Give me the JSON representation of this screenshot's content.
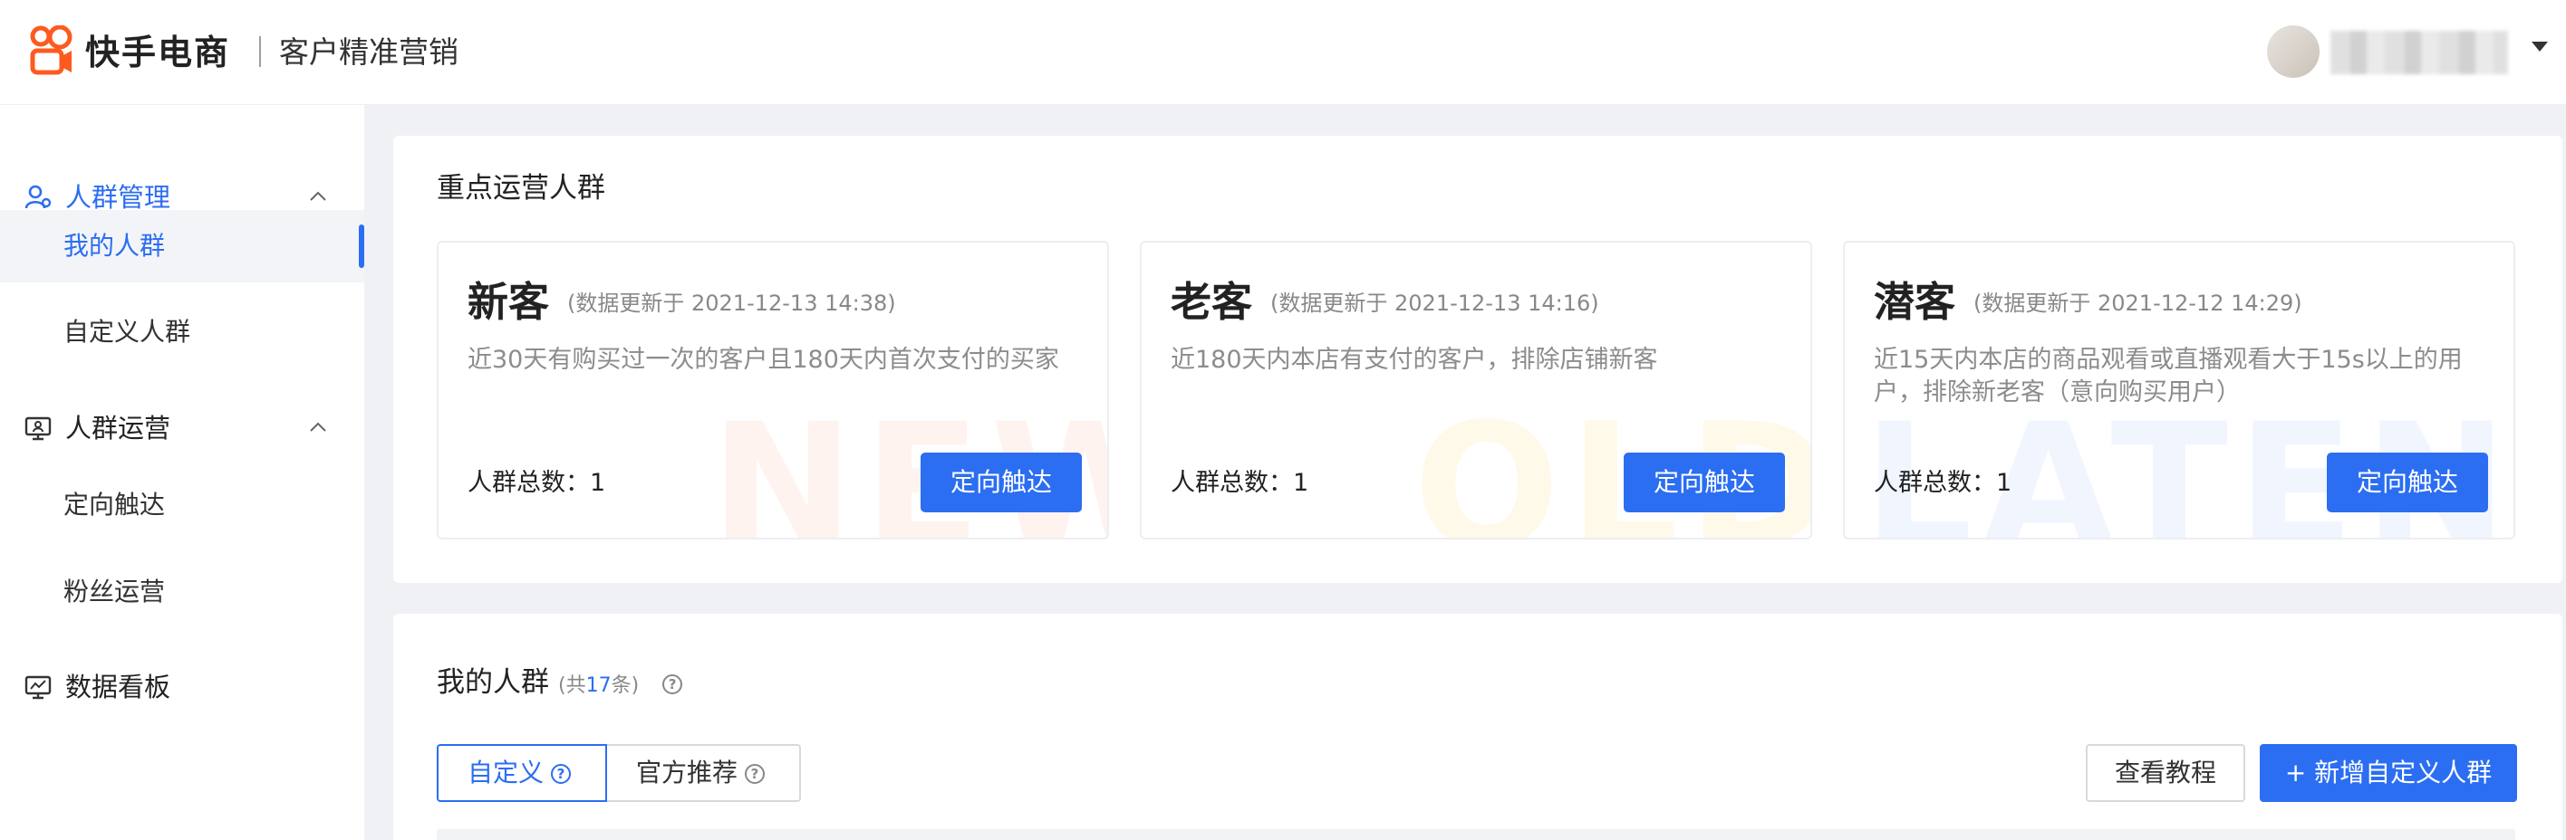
{
  "header": {
    "brand": "快手电商",
    "product": "客户精准营销",
    "brand_color": "#fe5a1f"
  },
  "sidebar": {
    "groups": [
      {
        "label": "人群管理",
        "icon": "user-icon",
        "expanded": true,
        "active": true,
        "items": [
          {
            "label": "我的人群",
            "active": true
          },
          {
            "label": "自定义人群",
            "active": false
          }
        ]
      },
      {
        "label": "人群运营",
        "icon": "monitor-icon",
        "expanded": true,
        "active": false,
        "items": [
          {
            "label": "定向触达",
            "active": false
          },
          {
            "label": "粉丝运营",
            "active": false
          }
        ]
      },
      {
        "label": "数据看板",
        "icon": "chart-monitor-icon",
        "expanded": false,
        "active": false,
        "items": []
      }
    ]
  },
  "key_segments": {
    "title": "重点运营人群",
    "cards": [
      {
        "title": "新客",
        "updated": "(数据更新于 2021-12-13 14:38)",
        "desc": "近30天有购买过一次的客户且180天内首次支付的买家",
        "count_label": "人群总数：",
        "count": "1",
        "button": "定向触达",
        "watermark": "NEW",
        "watermark_color": "#fff3f0"
      },
      {
        "title": "老客",
        "updated": "(数据更新于 2021-12-13 14:16)",
        "desc": "近180天内本店有支付的客户，排除店铺新客",
        "count_label": "人群总数：",
        "count": "1",
        "button": "定向触达",
        "watermark": "OLD",
        "watermark_color": "#fff9ea"
      },
      {
        "title": "潜客",
        "updated": "(数据更新于 2021-12-12 14:29)",
        "desc": "近15天内本店的商品观看或直播观看大于15s以上的用户，排除新老客（意向购买用户）",
        "count_label": "人群总数：",
        "count": "1",
        "button": "定向触达",
        "watermark": "LATENT",
        "watermark_color": "#f1f5fe"
      }
    ]
  },
  "my_segments": {
    "title": "我的人群",
    "total_prefix": "(共",
    "total": "17",
    "total_suffix": "条)",
    "tabs": [
      {
        "label": "自定义",
        "active": true
      },
      {
        "label": "官方推荐",
        "active": false
      }
    ],
    "tutorial_button": "查看教程",
    "add_button": "+ 新增自定义人群"
  },
  "colors": {
    "accent": "#2b6ef2",
    "background": "#f0f1f5"
  }
}
